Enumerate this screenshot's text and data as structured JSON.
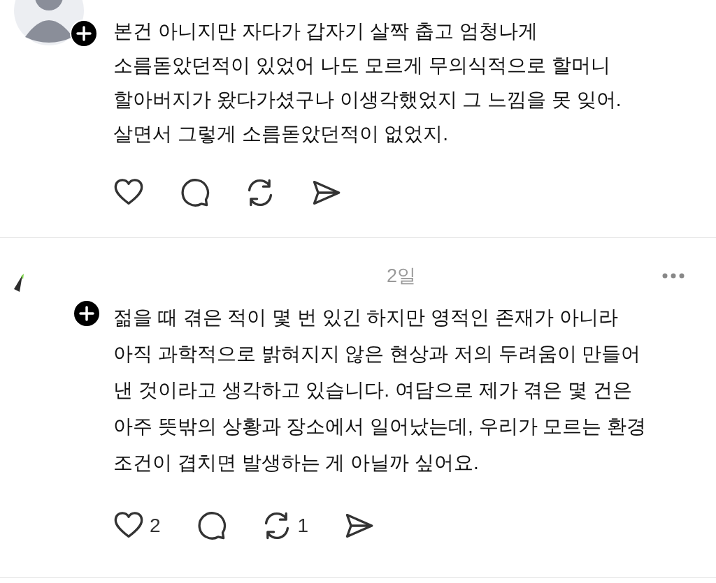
{
  "posts": [
    {
      "kind": "default",
      "text": "본건 아니지만 자다가 갑자기 살짝 춥고 엄청나게\n소름돋았던적이 있었어 나도 모르게 무의식적으로 할머니\n할아버지가 왔다가셨구나 이생각했었지 그 느낌을 못 잊어.\n살면서 그렇게 소름돋았던적이 없었지.",
      "actions": [
        {
          "kind": "like"
        },
        {
          "kind": "reply"
        },
        {
          "kind": "repost"
        },
        {
          "kind": "share"
        }
      ]
    },
    {
      "kind": "hidden",
      "time": "2일",
      "text": "젊을 때 겪은 적이 몇 번 있긴 하지만 영적인 존재가 아니라\n아직 과학적으로 밝혀지지 않은 현상과 저의 두려움이 만들어\n낸 것이라고 생각하고 있습니다. 여담으로 제가 겪은 몇 건은\n아주 뜻밖의 상황과 장소에서 일어났는데, 우리가 모르는 환경\n조건이 겹치면 발생하는 게 아닐까 싶어요.",
      "actions": [
        {
          "kind": "like",
          "count": "2"
        },
        {
          "kind": "reply"
        },
        {
          "kind": "repost",
          "count": "1"
        },
        {
          "kind": "share"
        }
      ]
    }
  ]
}
